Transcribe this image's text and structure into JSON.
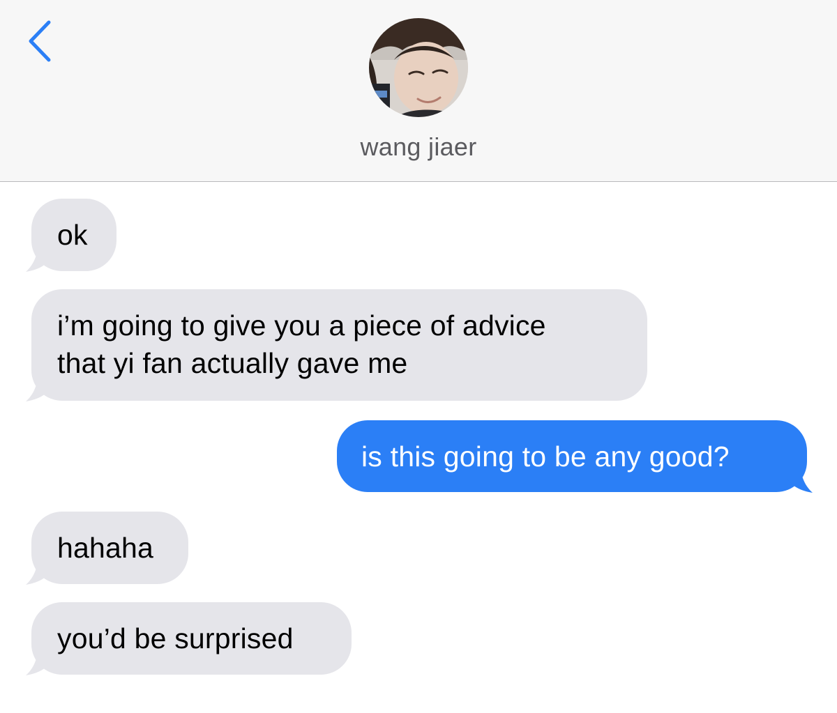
{
  "header": {
    "back_icon": "chevron-left-icon",
    "contact_name": "wang jiaer"
  },
  "colors": {
    "header_background": "#f7f7f7",
    "incoming_bubble": "#e5e5ea",
    "outgoing_bubble": "#2b7ff6",
    "back_chevron": "#2b7ff6"
  },
  "messages": [
    {
      "direction": "incoming",
      "lines": [
        "ok"
      ]
    },
    {
      "direction": "incoming",
      "lines": [
        "i’m going to give you a piece of advice",
        "that yi fan actually gave me"
      ]
    },
    {
      "direction": "outgoing",
      "lines": [
        "is this going to be any good?"
      ]
    },
    {
      "direction": "incoming",
      "lines": [
        "hahaha"
      ]
    },
    {
      "direction": "incoming",
      "lines": [
        "you’d be surprised"
      ]
    }
  ]
}
